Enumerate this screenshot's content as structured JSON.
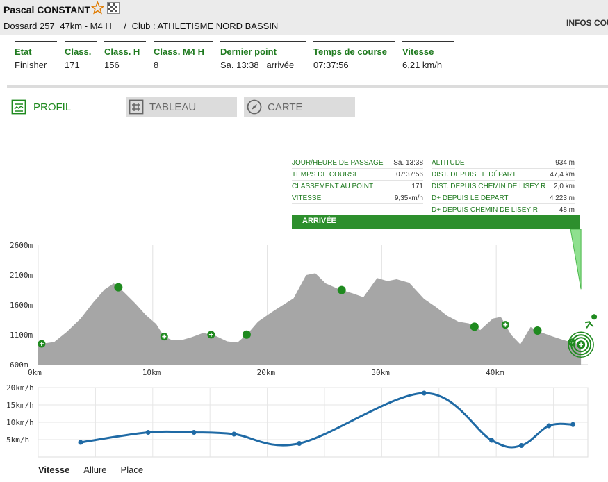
{
  "header": {
    "runner_name": "Pascal CONSTANT",
    "bib": "Dossard 257",
    "race": "47km - M4 H",
    "separator": "/",
    "club": "Club : ATHLETISME NORD BASSIN",
    "infos_link": "INFOS COU"
  },
  "stats": [
    {
      "label": "Etat",
      "value": "Finisher"
    },
    {
      "label": "Class.",
      "value": "171"
    },
    {
      "label": "Class. H",
      "value": "156"
    },
    {
      "label": "Class. M4 H",
      "value": "8"
    },
    {
      "label": "Dernier point",
      "value": "Sa. 13:38   arrivée"
    },
    {
      "label": "Temps de course",
      "value": "07:37:56"
    },
    {
      "label": "Vitesse",
      "value": "6,21 km/h"
    }
  ],
  "tabs": {
    "profil": "PROFIL",
    "tableau": "TABLEAU",
    "carte": "CARTE"
  },
  "point_info": {
    "left": [
      {
        "key": "JOUR/HEURE DE PASSAGE",
        "value": "Sa. 13:38"
      },
      {
        "key": "TEMPS DE COURSE",
        "value": "07:37:56"
      },
      {
        "key": "CLASSEMENT AU POINT",
        "value": "171"
      },
      {
        "key": "VITESSE",
        "value": "9,35km/h"
      }
    ],
    "right": [
      {
        "key": "ALTITUDE",
        "value": "934 m"
      },
      {
        "key": "DIST. DEPUIS LE DÉPART",
        "value": "47,4 km"
      },
      {
        "key": "DIST. DEPUIS CHEMIN DE LISEY R",
        "value": "2,0 km"
      },
      {
        "key": "D+ DEPUIS LE DÉPART",
        "value": "4 223 m"
      },
      {
        "key": "D+ DEPUIS CHEMIN DE LISEY R",
        "value": "48 m"
      }
    ],
    "banner": "ARRIVÉE"
  },
  "colors": {
    "accent_green": "#1f8a1f",
    "profile_fill": "#a6a6a6",
    "speed_line": "#1f6aa5"
  },
  "chart_data": [
    {
      "type": "area",
      "name": "profile",
      "x_unit": "km",
      "xlim": [
        0,
        48
      ],
      "ylim": [
        600,
        2600
      ],
      "x_ticks": [
        0,
        10,
        20,
        30,
        40
      ],
      "x_tick_labels": [
        "0km",
        "10km",
        "20km",
        "30km",
        "40km"
      ],
      "y_ticks": [
        2600,
        2100,
        1600,
        1100,
        600
      ],
      "y_tick_labels": [
        "2600m",
        "2100m",
        "1600m",
        "1100m",
        "600m"
      ],
      "x": [
        0,
        1.4,
        2.5,
        3.7,
        4.8,
        5.8,
        6.6,
        7.4,
        8.5,
        9.4,
        10.3,
        11,
        11.7,
        12.5,
        13.4,
        14.4,
        15.4,
        16.5,
        17.4,
        18.3,
        19.2,
        20.4,
        21.3,
        22.3,
        23.4,
        24.2,
        25.1,
        26.3,
        27.5,
        28.4,
        29.6,
        30.5,
        31.3,
        32.4,
        33.7,
        34.7,
        35.7,
        36.7,
        37.6,
        38.6,
        39.7,
        40.4,
        41.3,
        42.1,
        43,
        43.8,
        44.8,
        45.9,
        47.4
      ],
      "elevation": [
        940,
        980,
        1150,
        1370,
        1640,
        1860,
        1960,
        1830,
        1620,
        1430,
        1280,
        1070,
        1010,
        1010,
        1060,
        1130,
        1090,
        990,
        970,
        1120,
        1320,
        1480,
        1590,
        1710,
        2100,
        2130,
        1960,
        1860,
        1790,
        1730,
        2050,
        2000,
        2030,
        1970,
        1700,
        1570,
        1420,
        1320,
        1290,
        1180,
        1370,
        1400,
        1100,
        940,
        1230,
        1150,
        1080,
        1010,
        934
      ],
      "checkpoints_km": [
        0.3,
        7,
        11,
        15.1,
        18.2,
        26.5,
        38.1,
        40.8,
        43.6,
        46.6,
        47.4
      ],
      "checkpoint_kind": [
        "plus",
        "dot",
        "plus",
        "plus",
        "dot",
        "dot",
        "dot",
        "plus",
        "dot",
        "plus",
        "finish"
      ]
    },
    {
      "type": "line",
      "name": "speed",
      "x_unit": "km",
      "xlim": [
        0,
        48
      ],
      "ylim": [
        0,
        20
      ],
      "y_ticks": [
        20,
        15,
        10,
        5
      ],
      "y_tick_labels": [
        "20km/h",
        "15km/h",
        "10km/h",
        "5km/h"
      ],
      "x": [
        3.7,
        9.6,
        13.6,
        17.1,
        22.8,
        33.7,
        39.6,
        42.2,
        44.6,
        46.7
      ],
      "values": [
        4.2,
        7.1,
        7.1,
        6.6,
        3.9,
        18.4,
        4.8,
        3.3,
        9.0,
        9.35
      ]
    }
  ],
  "bottom_tabs": [
    "Vitesse",
    "Allure",
    "Place"
  ]
}
